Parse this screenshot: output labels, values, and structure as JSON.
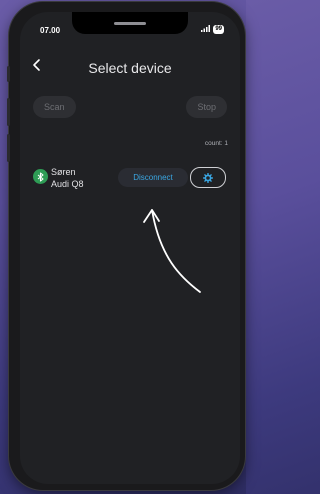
{
  "status": {
    "time": "07.00",
    "battery": "99"
  },
  "header": {
    "back_label": "<",
    "title": "Select device"
  },
  "controls": {
    "scan_label": "Scan",
    "stop_label": "Stop"
  },
  "device_count": "count: 1",
  "devices": [
    {
      "name_line1": "Søren",
      "name_line2": "Audi Q8",
      "action_label": "Disconnect",
      "icon": "bluetooth-icon"
    }
  ],
  "colors": {
    "accent": "#3aa7e3",
    "bluetooth_badge": "#2e9c55",
    "background": "#202124"
  }
}
